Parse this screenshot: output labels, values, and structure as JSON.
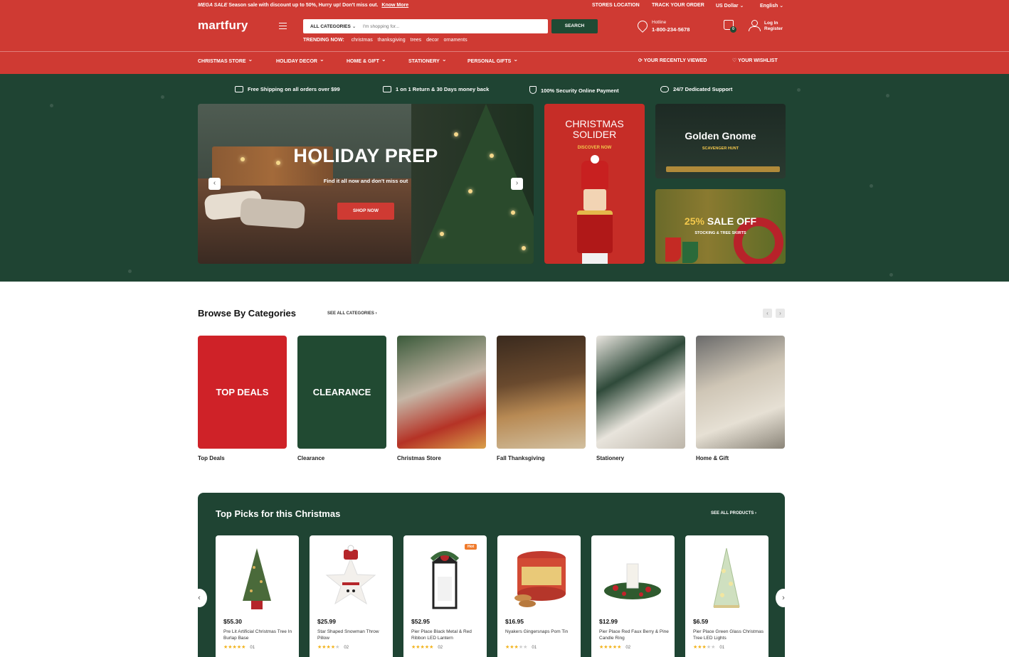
{
  "topbar": {
    "mega": "MEGA SALE",
    "promo": "Season sale with discount up to 50%, Hurry up! Don't miss out.",
    "know_more": "Know More",
    "stores": "STORES LOCATION",
    "track": "TRACK YOUR ORDER",
    "currency": "US Dollar",
    "language": "English"
  },
  "header": {
    "logo": "martfury",
    "category_select": "ALL CATEGORIES",
    "search_placeholder": "I'm shopping for...",
    "search_button": "SEARCH",
    "trending_label": "TRENDING NOW:",
    "trending": [
      "christmas",
      "thanksgiving",
      "trees",
      "decor",
      "ornaments"
    ],
    "hotline_label": "Hotline",
    "hotline_number": "1-800-234-5678",
    "cart_count": "0",
    "login": "Log In",
    "register": "Register"
  },
  "nav": {
    "items": [
      "CHRISTMAS STORE",
      "HOLIDAY DECOR",
      "HOME & GIFT",
      "STATIONERY",
      "PERSONAL GIFTS"
    ],
    "recently_viewed": "YOUR RECENTLY VIEWED",
    "wishlist": "YOUR WISHLIST"
  },
  "features": [
    "Free Shipping on all orders over $99",
    "1 on 1 Return & 30 Days money back",
    "100% Security Online Payment",
    "24/7 Dedicated Support"
  ],
  "hero": {
    "title": "HOLIDAY PREP",
    "subtitle": "Find it all now and don't miss out",
    "button": "SHOP NOW"
  },
  "promo1": {
    "title_line1": "CHRISTMAS",
    "title_line2": "SOLIDER",
    "link": "DISCOVER NOW"
  },
  "promo2": {
    "title": "Golden Gnome",
    "subtitle": "SCAVENGER HUNT"
  },
  "promo3": {
    "percent": "25%",
    "title": "SALE OFF",
    "subtitle": "STOCKING & TREE SKIRTS"
  },
  "categories": {
    "title": "Browse By Categories",
    "see_all": "SEE ALL CATEGORIES",
    "items": [
      {
        "label": "Top Deals",
        "overlay": "TOP DEALS",
        "color": "#cf2228"
      },
      {
        "label": "Clearance",
        "overlay": "CLEARANCE",
        "color": "#214a32"
      },
      {
        "label": "Christmas Store",
        "overlay": ""
      },
      {
        "label": "Fall Thanksgiving",
        "overlay": ""
      },
      {
        "label": "Stationery",
        "overlay": ""
      },
      {
        "label": "Home & Gift",
        "overlay": ""
      }
    ]
  },
  "picks": {
    "title": "Top Picks for this Christmas",
    "see_all": "SEE ALL PRODUCTS",
    "products": [
      {
        "price": "$55.30",
        "name": "Pre Lit Artificial Christmas Tree In Burlap Base",
        "stars": 5,
        "count": "01",
        "badge": ""
      },
      {
        "price": "$25.99",
        "name": "Star Shaped Snowman Throw Pillow",
        "stars": 4,
        "count": "02",
        "badge": ""
      },
      {
        "price": "$52.95",
        "name": "Pier Place Black Metal & Red Ribbon LED Lantern",
        "stars": 5,
        "count": "02",
        "badge": "Hot"
      },
      {
        "price": "$16.95",
        "name": "Nyakers Gingersnaps Pom Tin",
        "stars": 3,
        "count": "01",
        "badge": ""
      },
      {
        "price": "$12.99",
        "name": "Pier Place Red Faux Berry & Pine Candle Ring",
        "stars": 5,
        "count": "02",
        "badge": ""
      },
      {
        "price": "$6.59",
        "name": "Pier Place Green Glass Christmas Tree LED Lights",
        "stars": 3,
        "count": "01",
        "badge": ""
      }
    ]
  },
  "colors": {
    "brand_red": "#cf3a33",
    "forest_green": "#1f4433",
    "gold": "#f3c84c",
    "star": "#f2b31c"
  },
  "icons": [
    "truck-icon",
    "card-icon",
    "shield-icon",
    "chat-icon",
    "phone-icon",
    "cart-icon",
    "user-icon",
    "menu-icon",
    "refresh-icon",
    "heart-icon",
    "chevron-down-icon",
    "arrow-left-icon",
    "arrow-right-icon"
  ]
}
